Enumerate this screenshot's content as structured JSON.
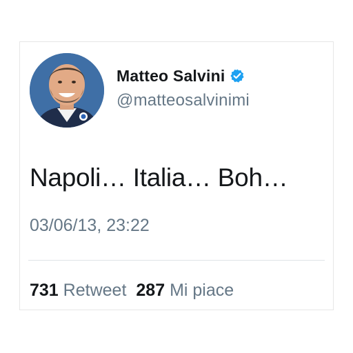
{
  "profile": {
    "display_name": "Matteo Salvini",
    "handle": "@matteosalvinimi",
    "verified_icon": "verified-badge-icon",
    "avatar_description": "avatar"
  },
  "tweet": {
    "text": "Napoli… Italia… Boh…",
    "timestamp": "03/06/13, 23:22"
  },
  "stats": {
    "retweets_count": "731",
    "retweets_label": "Retweet",
    "likes_count": "287",
    "likes_label": "Mi piace"
  },
  "colors": {
    "text_primary": "#14171a",
    "text_secondary": "#657786",
    "verified_blue": "#1da1f2",
    "divider": "#dfe3e6",
    "avatar_bg": "#3f6fa6"
  }
}
